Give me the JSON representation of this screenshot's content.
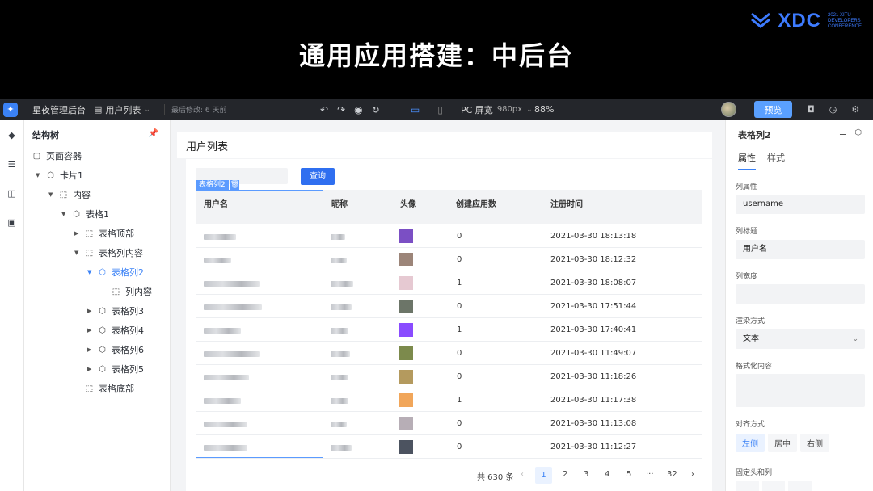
{
  "slide": {
    "title": "通用应用搭建：中后台",
    "logo_word": "XDC",
    "logo_small": [
      "2021 XITU",
      "DEVELOPERS",
      "CONFERENCE"
    ]
  },
  "topbar": {
    "app_name": "星夜管理后台",
    "page_name": "用户列表",
    "last_edit": "最后修改: 6 天前",
    "screen": "PC 屏宽",
    "screen_px": "980px",
    "zoom": "88%",
    "preview": "预览"
  },
  "tree": {
    "title": "结构树",
    "nodes": [
      {
        "label": "页面容器"
      },
      {
        "label": "卡片1"
      },
      {
        "label": "内容"
      },
      {
        "label": "表格1"
      },
      {
        "label": "表格顶部"
      },
      {
        "label": "表格列内容"
      },
      {
        "label": "表格列2"
      },
      {
        "label": "列内容"
      },
      {
        "label": "表格列3"
      },
      {
        "label": "表格列4"
      },
      {
        "label": "表格列6"
      },
      {
        "label": "表格列5"
      },
      {
        "label": "表格底部"
      }
    ]
  },
  "canvas": {
    "page_title": "用户列表",
    "search_button": "查询",
    "selected_tag": "表格列2",
    "table": {
      "headers": [
        "用户名",
        "昵称",
        "头像",
        "创建应用数",
        "注册时间"
      ],
      "rows": [
        {
          "apps": "0",
          "time": "2021-03-30 18:13:18",
          "color": "#7b4fc4"
        },
        {
          "apps": "0",
          "time": "2021-03-30 18:12:32",
          "color": "#9c8579"
        },
        {
          "apps": "1",
          "time": "2021-03-30 18:08:07",
          "color": "#e6c9d2"
        },
        {
          "apps": "0",
          "time": "2021-03-30 17:51:44",
          "color": "#6c7568"
        },
        {
          "apps": "1",
          "time": "2021-03-30 17:40:41",
          "color": "#8a4cff"
        },
        {
          "apps": "0",
          "time": "2021-03-30 11:49:07",
          "color": "#7c8a4c"
        },
        {
          "apps": "0",
          "time": "2021-03-30 11:18:26",
          "color": "#b49a5e"
        },
        {
          "apps": "1",
          "time": "2021-03-30 11:17:38",
          "color": "#f1a65a"
        },
        {
          "apps": "0",
          "time": "2021-03-30 11:13:08",
          "color": "#b7aeb6"
        },
        {
          "apps": "0",
          "time": "2021-03-30 11:12:27",
          "color": "#4c5360"
        }
      ]
    },
    "pager": {
      "total": "共 630 条",
      "pages": [
        "1",
        "2",
        "3",
        "4",
        "5",
        "···",
        "32"
      ],
      "current": "1"
    }
  },
  "props": {
    "title": "表格列2",
    "tab_attr": "属性",
    "tab_style": "样式",
    "col_attr_label": "列属性",
    "col_attr_value": "username",
    "col_title_label": "列标题",
    "col_title_value": "用户名",
    "col_width_label": "列宽度",
    "render_label": "渲染方式",
    "render_value": "文本",
    "format_label": "格式化内容",
    "align_label": "对齐方式",
    "align_left": "左侧",
    "align_center": "居中",
    "align_right": "右侧",
    "fixed_label": "固定头和列"
  }
}
